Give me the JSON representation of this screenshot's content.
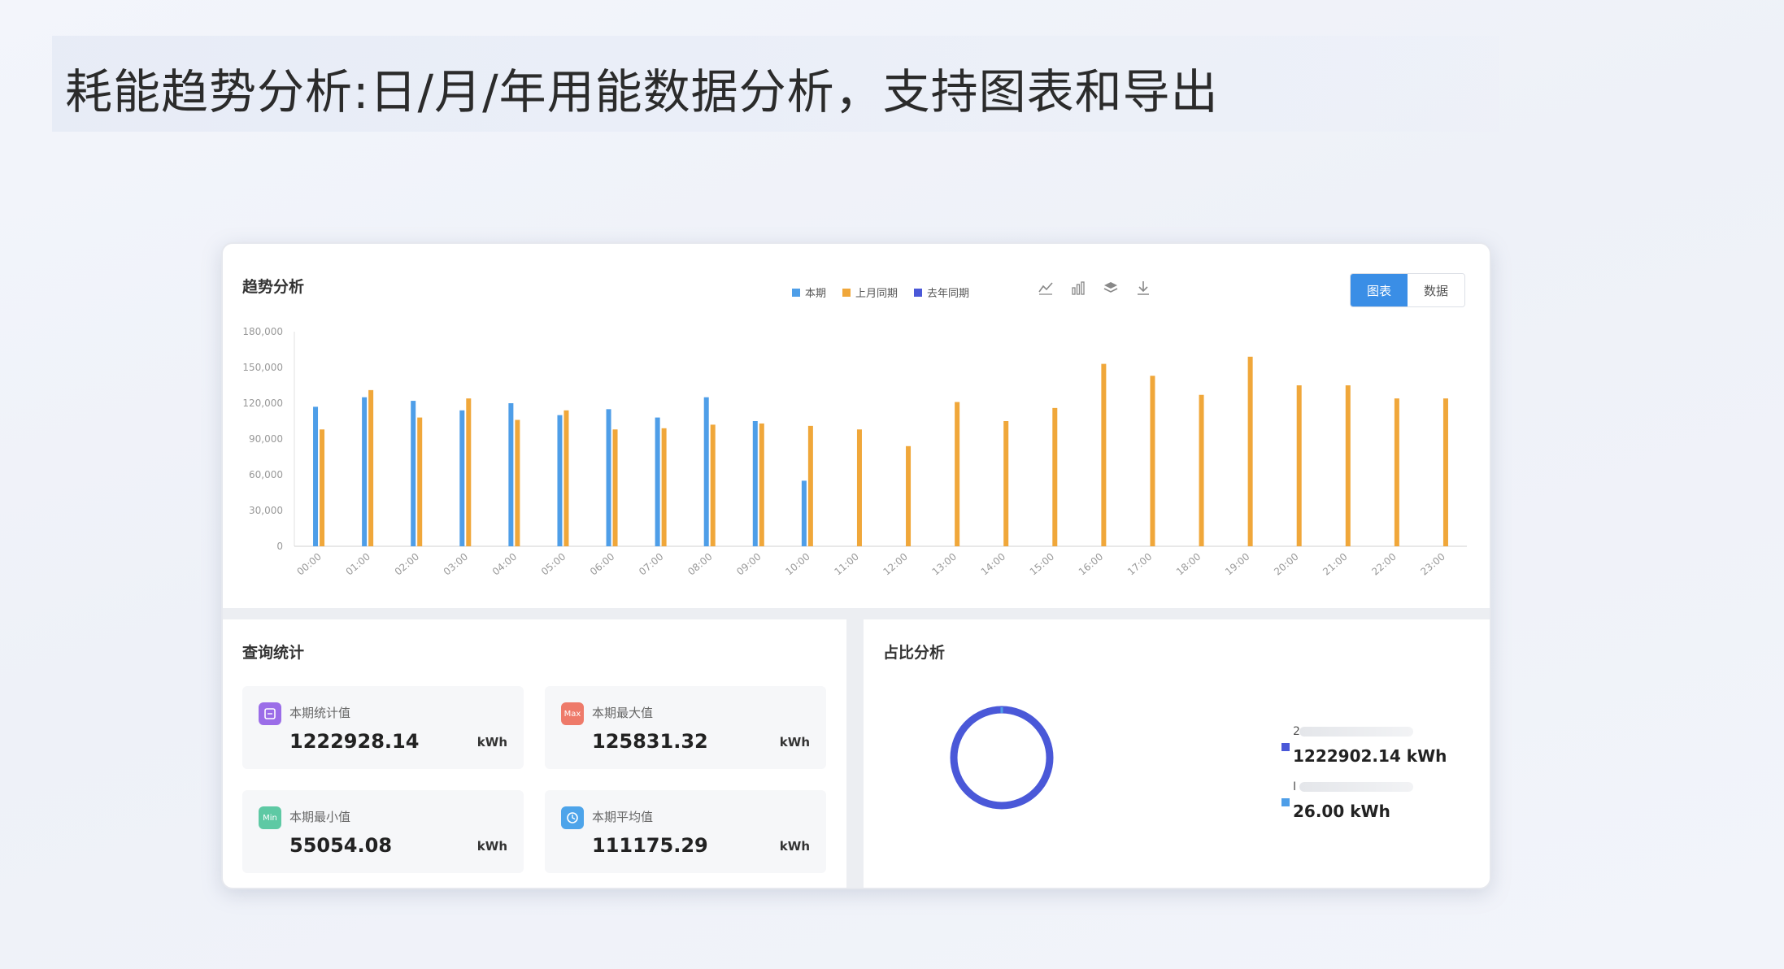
{
  "slide": {
    "title": "耗能趋势分析:日/月/年用能数据分析，支持图表和导出"
  },
  "trend": {
    "title": "趋势分析",
    "legend": [
      {
        "name": "本期",
        "color": "#4e9ee8"
      },
      {
        "name": "上月同期",
        "color": "#f0a73a"
      },
      {
        "name": "去年同期",
        "color": "#4a58d8"
      }
    ],
    "toolbox": [
      "line-chart-icon",
      "bar-chart-icon",
      "stack-icon",
      "download-icon"
    ],
    "view_toggle": {
      "chart": "图表",
      "data": "数据",
      "active": "chart"
    }
  },
  "chart_data": {
    "type": "bar",
    "categories": [
      "00:00",
      "01:00",
      "02:00",
      "03:00",
      "04:00",
      "05:00",
      "06:00",
      "07:00",
      "08:00",
      "09:00",
      "10:00",
      "11:00",
      "12:00",
      "13:00",
      "14:00",
      "15:00",
      "16:00",
      "17:00",
      "18:00",
      "19:00",
      "20:00",
      "21:00",
      "22:00",
      "23:00"
    ],
    "series": [
      {
        "name": "本期",
        "color": "#4e9ee8",
        "values": [
          117000,
          125000,
          122000,
          114000,
          120000,
          110000,
          115000,
          108000,
          125000,
          105000,
          55000,
          null,
          null,
          null,
          null,
          null,
          null,
          null,
          null,
          null,
          null,
          null,
          null,
          null
        ]
      },
      {
        "name": "上月同期",
        "color": "#f0a73a",
        "values": [
          98000,
          131000,
          108000,
          124000,
          106000,
          114000,
          98000,
          99000,
          102000,
          103000,
          101000,
          98000,
          84000,
          121000,
          105000,
          116000,
          153000,
          143000,
          127000,
          159000,
          135000,
          135000,
          124000,
          124000
        ]
      }
    ],
    "yticks": [
      "0",
      "30,000",
      "60,000",
      "90,000",
      "120,000",
      "150,000",
      "180,000"
    ],
    "ylim": [
      0,
      180000
    ],
    "title": "",
    "xlabel": "",
    "ylabel": ""
  },
  "stats": {
    "title": "查询统计",
    "items": [
      {
        "icon": "sum-icon",
        "icon_color": "#9b6de8",
        "icon_text": "",
        "label": "本期统计值",
        "value": "1222928.14",
        "unit": "kWh"
      },
      {
        "icon": "max-icon",
        "icon_color": "#ee7a6a",
        "icon_text": "Max",
        "label": "本期最大值",
        "value": "125831.32",
        "unit": "kWh"
      },
      {
        "icon": "min-icon",
        "icon_color": "#5ec9a4",
        "icon_text": "Min",
        "label": "本期最小值",
        "value": "55054.08",
        "unit": "kWh"
      },
      {
        "icon": "clock-icon",
        "icon_color": "#4da4ea",
        "icon_text": "",
        "label": "本期平均值",
        "value": "111175.29",
        "unit": "kWh"
      }
    ]
  },
  "ratio": {
    "title": "占比分析",
    "entries": [
      {
        "name": "2",
        "value": "1222902.14 kWh",
        "color": "#4a58d8"
      },
      {
        "name": "I",
        "value": "26.00 kWh",
        "color": "#4e9ee8"
      }
    ]
  }
}
